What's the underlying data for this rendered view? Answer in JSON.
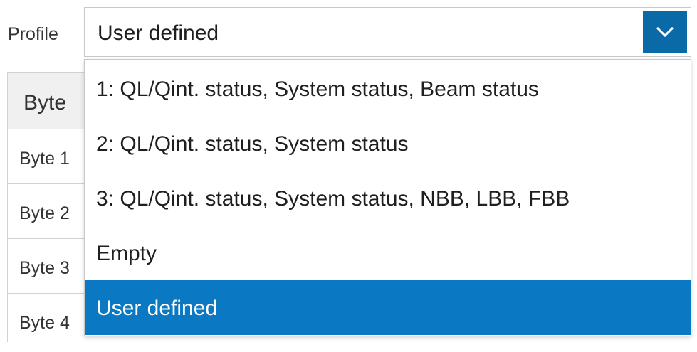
{
  "profile": {
    "label": "Profile",
    "selected_value": "User defined",
    "arrow_icon": "chevron-down-icon",
    "options": [
      "1: QL/Qint. status, System status, Beam status",
      "2: QL/Qint. status, System status",
      "3: QL/Qint. status, System status, NBB, LBB, FBB",
      "Empty",
      "User defined"
    ],
    "selected_index": 4
  },
  "table": {
    "header": "Byte",
    "rows": [
      "Byte 1",
      "Byte 2",
      "Byte 3",
      "Byte 4"
    ]
  },
  "colors": {
    "accent": "#0a6aa8",
    "selected_option_bg": "#0a78c2",
    "header_bg": "#f0f0f0",
    "border": "#d2d2d2"
  }
}
